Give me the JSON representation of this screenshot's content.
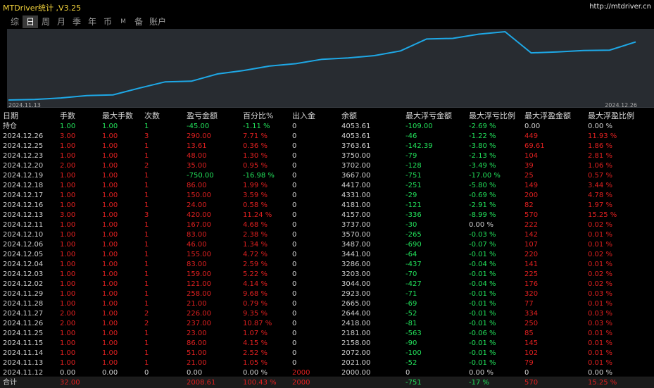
{
  "app": {
    "title": "MTDriver统计 ,V3.25",
    "url": "http://mtdriver.cn"
  },
  "tabs": [
    {
      "label": "综"
    },
    {
      "label": "日"
    },
    {
      "label": "周"
    },
    {
      "label": "月"
    },
    {
      "label": "季"
    },
    {
      "label": "年"
    },
    {
      "label": "币"
    },
    {
      "label": "M"
    },
    {
      "label": "备"
    },
    {
      "label": "账户"
    }
  ],
  "chart": {
    "start_date": "2024.11.13",
    "end_date": "2024.12.26",
    "line_color": "#1ea8e6"
  },
  "chart_data": {
    "type": "line",
    "x": [
      "2024.11.12",
      "2024.11.13",
      "2024.11.14",
      "2024.11.15",
      "2024.11.25",
      "2024.11.26",
      "2024.11.27",
      "2024.11.28",
      "2024.11.29",
      "2024.12.02",
      "2024.12.03",
      "2024.12.04",
      "2024.12.05",
      "2024.12.06",
      "2024.12.10",
      "2024.12.11",
      "2024.12.13",
      "2024.12.16",
      "2024.12.17",
      "2024.12.18",
      "2024.12.19",
      "2024.12.20",
      "2024.12.23",
      "2024.12.25",
      "2024.12.26"
    ],
    "values": [
      2000,
      2021,
      2072,
      2158,
      2181,
      2418,
      2644,
      2665,
      2923,
      3044,
      3203,
      3286,
      3441,
      3487,
      3570,
      3737,
      4157,
      4181,
      4331,
      4417,
      3667,
      3702,
      3750,
      3763.61,
      4053.61
    ]
  },
  "headers": [
    "日期",
    "手数",
    "最大手数",
    "次数",
    "盈亏金额",
    "百分比%",
    "出入金",
    "余额",
    "最大浮亏金额",
    "最大浮亏比例",
    "最大浮盈金额",
    "最大浮盈比例"
  ],
  "position_row": [
    "持仓",
    "1.00",
    "1.00",
    "1",
    "-45.00",
    "-1.11 %",
    "0",
    "4053.61",
    "-109.00",
    "-2.69 %",
    "0.00",
    "0.00 %"
  ],
  "rows": [
    [
      "2024.12.26",
      "3.00",
      "1.00",
      "3",
      "290.00",
      "7.71 %",
      "0",
      "4053.61",
      "-46",
      "-1.22 %",
      "449",
      "11.93 %"
    ],
    [
      "2024.12.25",
      "1.00",
      "1.00",
      "1",
      "13.61",
      "0.36 %",
      "0",
      "3763.61",
      "-142.39",
      "-3.80 %",
      "69.61",
      "1.86 %"
    ],
    [
      "2024.12.23",
      "1.00",
      "1.00",
      "1",
      "48.00",
      "1.30 %",
      "0",
      "3750.00",
      "-79",
      "-2.13 %",
      "104",
      "2.81 %"
    ],
    [
      "2024.12.20",
      "2.00",
      "1.00",
      "2",
      "35.00",
      "0.95 %",
      "0",
      "3702.00",
      "-128",
      "-3.49 %",
      "39",
      "1.06 %"
    ],
    [
      "2024.12.19",
      "1.00",
      "1.00",
      "1",
      "-750.00",
      "-16.98 %",
      "0",
      "3667.00",
      "-751",
      "-17.00 %",
      "25",
      "0.57 %"
    ],
    [
      "2024.12.18",
      "1.00",
      "1.00",
      "1",
      "86.00",
      "1.99 %",
      "0",
      "4417.00",
      "-251",
      "-5.80 %",
      "149",
      "3.44 %"
    ],
    [
      "2024.12.17",
      "1.00",
      "1.00",
      "1",
      "150.00",
      "3.59 %",
      "0",
      "4331.00",
      "-29",
      "-0.69 %",
      "200",
      "4.78 %"
    ],
    [
      "2024.12.16",
      "1.00",
      "1.00",
      "1",
      "24.00",
      "0.58 %",
      "0",
      "4181.00",
      "-121",
      "-2.91 %",
      "82",
      "1.97 %"
    ],
    [
      "2024.12.13",
      "3.00",
      "1.00",
      "3",
      "420.00",
      "11.24 %",
      "0",
      "4157.00",
      "-336",
      "-8.99 %",
      "570",
      "15.25 %"
    ],
    [
      "2024.12.11",
      "1.00",
      "1.00",
      "1",
      "167.00",
      "4.68 %",
      "0",
      "3737.00",
      "-30",
      "0.00 %",
      "222",
      "0.02 %"
    ],
    [
      "2024.12.10",
      "1.00",
      "1.00",
      "1",
      "83.00",
      "2.38 %",
      "0",
      "3570.00",
      "-265",
      "-0.03 %",
      "142",
      "0.01 %"
    ],
    [
      "2024.12.06",
      "1.00",
      "1.00",
      "1",
      "46.00",
      "1.34 %",
      "0",
      "3487.00",
      "-690",
      "-0.07 %",
      "107",
      "0.01 %"
    ],
    [
      "2024.12.05",
      "1.00",
      "1.00",
      "1",
      "155.00",
      "4.72 %",
      "0",
      "3441.00",
      "-64",
      "-0.01 %",
      "220",
      "0.02 %"
    ],
    [
      "2024.12.04",
      "1.00",
      "1.00",
      "1",
      "83.00",
      "2.59 %",
      "0",
      "3286.00",
      "-437",
      "-0.04 %",
      "141",
      "0.01 %"
    ],
    [
      "2024.12.03",
      "1.00",
      "1.00",
      "1",
      "159.00",
      "5.22 %",
      "0",
      "3203.00",
      "-70",
      "-0.01 %",
      "225",
      "0.02 %"
    ],
    [
      "2024.12.02",
      "1.00",
      "1.00",
      "1",
      "121.00",
      "4.14 %",
      "0",
      "3044.00",
      "-427",
      "-0.04 %",
      "176",
      "0.02 %"
    ],
    [
      "2024.11.29",
      "1.00",
      "1.00",
      "1",
      "258.00",
      "9.68 %",
      "0",
      "2923.00",
      "-71",
      "-0.01 %",
      "320",
      "0.03 %"
    ],
    [
      "2024.11.28",
      "1.00",
      "1.00",
      "1",
      "21.00",
      "0.79 %",
      "0",
      "2665.00",
      "-69",
      "-0.01 %",
      "77",
      "0.01 %"
    ],
    [
      "2024.11.27",
      "2.00",
      "1.00",
      "2",
      "226.00",
      "9.35 %",
      "0",
      "2644.00",
      "-52",
      "-0.01 %",
      "334",
      "0.03 %"
    ],
    [
      "2024.11.26",
      "2.00",
      "1.00",
      "2",
      "237.00",
      "10.87 %",
      "0",
      "2418.00",
      "-81",
      "-0.01 %",
      "250",
      "0.03 %"
    ],
    [
      "2024.11.25",
      "1.00",
      "1.00",
      "1",
      "23.00",
      "1.07 %",
      "0",
      "2181.00",
      "-563",
      "-0.06 %",
      "85",
      "0.01 %"
    ],
    [
      "2024.11.15",
      "1.00",
      "1.00",
      "1",
      "86.00",
      "4.15 %",
      "0",
      "2158.00",
      "-90",
      "-0.01 %",
      "145",
      "0.01 %"
    ],
    [
      "2024.11.14",
      "1.00",
      "1.00",
      "1",
      "51.00",
      "2.52 %",
      "0",
      "2072.00",
      "-100",
      "-0.01 %",
      "102",
      "0.01 %"
    ],
    [
      "2024.11.13",
      "1.00",
      "1.00",
      "1",
      "21.00",
      "1.05 %",
      "0",
      "2021.00",
      "-52",
      "-0.01 %",
      "79",
      "0.01 %"
    ],
    [
      "2024.11.12",
      "0.00",
      "0.00",
      "0",
      "0.00",
      "0.00 %",
      "2000",
      "2000.00",
      "0",
      "0.00 %",
      "0",
      "0.00 %"
    ]
  ],
  "total_row": [
    "合计",
    "32.00",
    "",
    "",
    "2008.61",
    "100.43 %",
    "2000",
    "",
    "-751",
    "-17 %",
    "570",
    "15.25 %"
  ],
  "colors": {
    "red": "#e02020",
    "green": "#22e05a",
    "title_yellow": "#f2d23c"
  }
}
